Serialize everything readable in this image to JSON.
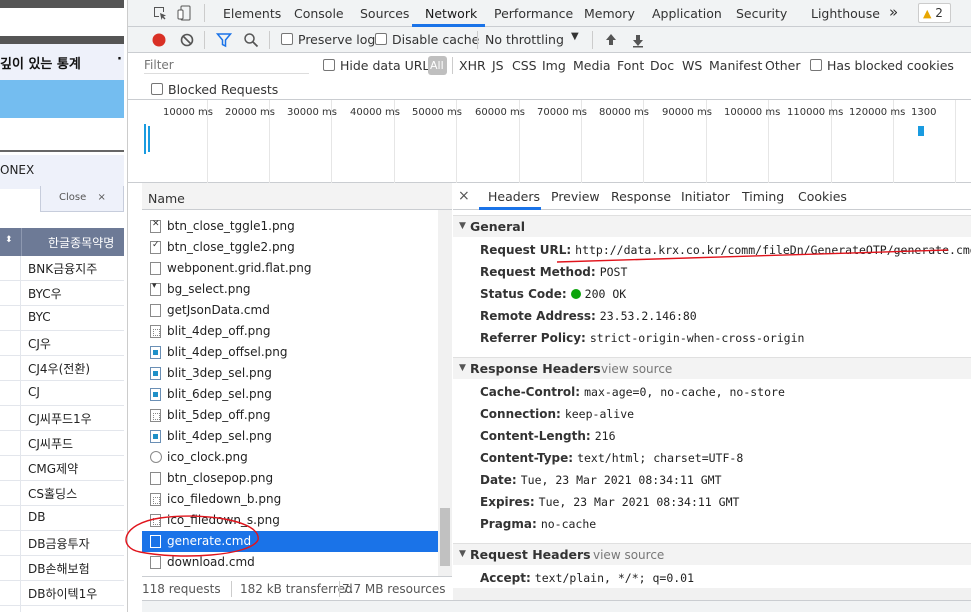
{
  "site": {
    "title": "깊이 있는 통계",
    "title_more": "·",
    "onex_label": "ONEX",
    "close_tab": "Close",
    "close_x": "×",
    "col_header": "한글종목약명",
    "col_sort": "⬍",
    "rows": [
      "BNK금융지주",
      "BYC우",
      "BYC",
      "CJ우",
      "CJ4우(전환)",
      "CJ",
      "CJ씨푸드1우",
      "CJ씨푸드",
      "CMG제약",
      "CS홀딩스",
      "DB",
      "DB금융투자",
      "DB손해보험",
      "DB하이텍1우",
      "DB하이텍"
    ]
  },
  "devtools": {
    "tabs": [
      "Elements",
      "Console",
      "Sources",
      "Network",
      "Performance",
      "Memory",
      "Application",
      "Security",
      "Lighthouse"
    ],
    "more_tabs": "»",
    "warnings": "2",
    "toolbar": {
      "preserve_log": "Preserve log",
      "disable_cache": "Disable cache",
      "throttling": "No throttling"
    },
    "filter": {
      "placeholder": "Filter",
      "hide_data_urls": "Hide data URLs",
      "all": "All",
      "types": [
        "XHR",
        "JS",
        "CSS",
        "Img",
        "Media",
        "Font",
        "Doc",
        "WS",
        "Manifest",
        "Other"
      ],
      "blocked_cookies": "Has blocked cookies",
      "blocked_requests": "Blocked Requests"
    },
    "timeline_ticks": [
      "10000 ms",
      "20000 ms",
      "30000 ms",
      "40000 ms",
      "50000 ms",
      "60000 ms",
      "70000 ms",
      "80000 ms",
      "90000 ms",
      "100000 ms",
      "110000 ms",
      "120000 ms",
      "1300"
    ],
    "list": {
      "header": "Name",
      "items": [
        {
          "name": "btn_close_tggle1.png",
          "icon": "x"
        },
        {
          "name": "btn_close_tggle2.png",
          "icon": "chk"
        },
        {
          "name": "webponent.grid.flat.png",
          "icon": "plain"
        },
        {
          "name": "bg_select.png",
          "icon": "arr"
        },
        {
          "name": "getJsonData.cmd",
          "icon": "plain"
        },
        {
          "name": "blit_4dep_off.png",
          "icon": "dots"
        },
        {
          "name": "blit_4dep_offsel.png",
          "icon": "blue"
        },
        {
          "name": "blit_3dep_sel.png",
          "icon": "blue"
        },
        {
          "name": "blit_6dep_sel.png",
          "icon": "blue"
        },
        {
          "name": "blit_5dep_off.png",
          "icon": "dots"
        },
        {
          "name": "blit_4dep_sel.png",
          "icon": "blue"
        },
        {
          "name": "ico_clock.png",
          "icon": "clock"
        },
        {
          "name": "btn_closepop.png",
          "icon": "plain"
        },
        {
          "name": "ico_filedown_b.png",
          "icon": "dots"
        },
        {
          "name": "ico_filedown_s.png",
          "icon": "dots"
        },
        {
          "name": "generate.cmd",
          "icon": "plain",
          "selected": true
        },
        {
          "name": "download.cmd",
          "icon": "plain"
        }
      ],
      "footer": {
        "requests": "118 requests",
        "transferred": "182 kB transferred",
        "resources": "7.7 MB resources"
      }
    },
    "details": {
      "tabs": [
        "Headers",
        "Preview",
        "Response",
        "Initiator",
        "Timing",
        "Cookies"
      ],
      "close": "×",
      "general": {
        "title": "General",
        "request_url_k": "Request URL:",
        "request_url": "http://data.krx.co.kr/comm/fileDn/GenerateOTP/generate.cmd",
        "method_k": "Request Method:",
        "method": "POST",
        "status_k": "Status Code:",
        "status": "200 OK",
        "remote_k": "Remote Address:",
        "remote": "23.53.2.146:80",
        "referrer_k": "Referrer Policy:",
        "referrer": "strict-origin-when-cross-origin"
      },
      "response_headers": {
        "title": "Response Headers",
        "view_source": "view source",
        "items": [
          {
            "k": "Cache-Control:",
            "v": "max-age=0, no-cache, no-store"
          },
          {
            "k": "Connection:",
            "v": "keep-alive"
          },
          {
            "k": "Content-Length:",
            "v": "216"
          },
          {
            "k": "Content-Type:",
            "v": "text/html; charset=UTF-8"
          },
          {
            "k": "Date:",
            "v": "Tue, 23 Mar 2021 08:34:11 GMT"
          },
          {
            "k": "Expires:",
            "v": "Tue, 23 Mar 2021 08:34:11 GMT"
          },
          {
            "k": "Pragma:",
            "v": "no-cache"
          }
        ]
      },
      "request_headers": {
        "title": "Request Headers",
        "view_source": "view source",
        "accept_k": "Accept:",
        "accept": "text/plain, */*; q=0.01"
      }
    },
    "colors": {
      "accent": "#1a73e8",
      "annotation": "#e0141c",
      "status_ok": "#0ca40c"
    }
  }
}
